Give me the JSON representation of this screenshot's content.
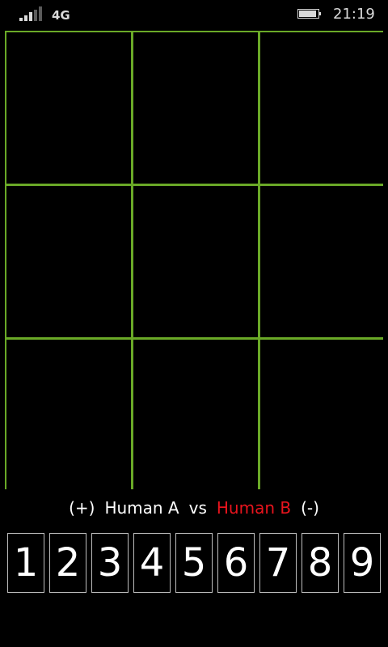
{
  "status_bar": {
    "network": "4G",
    "time": "21:19",
    "signal_bars_lit": 3,
    "signal_bars_total": 5,
    "battery_level": 0.95
  },
  "board": {
    "rows": 3,
    "columns": 3,
    "cells": [
      "",
      "",
      "",
      "",
      "",
      "",
      "",
      "",
      ""
    ],
    "grid_color": "#6aa927"
  },
  "score_line": {
    "plus": "(+)",
    "player_a": "Human A",
    "vs": "vs",
    "player_b": "Human B",
    "minus": "(-)",
    "active_player_color": "#e8141d"
  },
  "number_tiles": [
    "1",
    "2",
    "3",
    "4",
    "5",
    "6",
    "7",
    "8",
    "9"
  ],
  "colors": {
    "background": "#000000",
    "text": "#ffffff"
  }
}
